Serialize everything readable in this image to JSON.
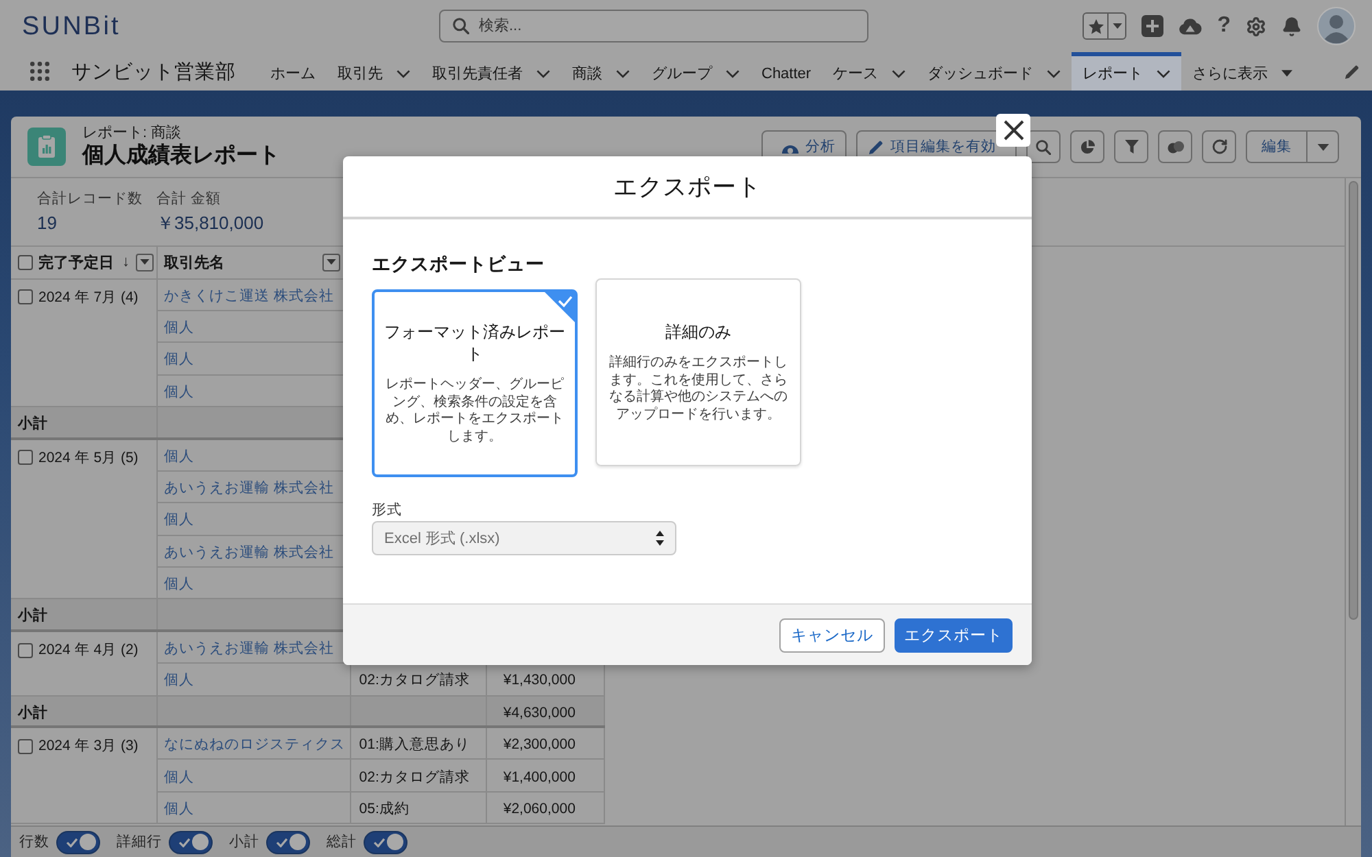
{
  "header": {
    "logo": "SUNBit",
    "search": {
      "placeholder": "検索..."
    },
    "help": "?"
  },
  "nav": {
    "app_name": "サンビット営業部",
    "items": [
      {
        "label": "ホーム",
        "menu": false,
        "selected": false
      },
      {
        "label": "取引先",
        "menu": true,
        "selected": false
      },
      {
        "label": "取引先責任者",
        "menu": true,
        "selected": false
      },
      {
        "label": "商談",
        "menu": true,
        "selected": false
      },
      {
        "label": "グループ",
        "menu": true,
        "selected": false
      },
      {
        "label": "Chatter",
        "menu": false,
        "selected": false
      },
      {
        "label": "ケース",
        "menu": true,
        "selected": false
      },
      {
        "label": "ダッシュボード",
        "menu": true,
        "selected": false
      },
      {
        "label": "レポート",
        "menu": true,
        "selected": true
      }
    ],
    "more": "さらに表示"
  },
  "report": {
    "type_label": "レポート: 商談",
    "title": "個人成績表レポート",
    "actions": [
      {
        "kind": "analyze",
        "label": "分析"
      },
      {
        "kind": "edit_fields",
        "label": "項目編集を有効"
      },
      {
        "kind": "search"
      },
      {
        "kind": "chart"
      },
      {
        "kind": "filter"
      },
      {
        "kind": "circles"
      },
      {
        "kind": "refresh"
      },
      {
        "kind": "edit",
        "label": "編集"
      }
    ]
  },
  "summary": [
    {
      "label": "合計レコード数",
      "value": "19"
    },
    {
      "label": "合計 金額",
      "value": "￥35,810,000"
    }
  ],
  "table": {
    "header_checkbox": {
      "checked": false
    },
    "columns": [
      {
        "label": "完了予定日",
        "sort_mark": "↓"
      },
      {
        "label": "取引先名"
      }
    ],
    "groups": [
      {
        "label": "2024 年 7月 (4)",
        "checked": false,
        "rows": [
          {
            "account": "かきくけこ運送 株式会社"
          },
          {
            "account": "個人"
          },
          {
            "account": "個人"
          },
          {
            "account": "個人"
          }
        ],
        "subtotal": {
          "label": "小計"
        }
      },
      {
        "label": "2024 年 5月 (5)",
        "checked": false,
        "rows": [
          {
            "account": "個人"
          },
          {
            "account": "あいうえお運輸 株式会社"
          },
          {
            "account": "個人"
          },
          {
            "account": "あいうえお運輸 株式会社"
          },
          {
            "account": "個人"
          }
        ],
        "subtotal": {
          "label": "小計"
        }
      },
      {
        "label": "2024 年 4月 (2)",
        "checked": false,
        "rows": [
          {
            "account": "あいうえお運輸 株式会社"
          },
          {
            "account": "個人",
            "column_3": "02:カタログ請求",
            "column_4": "¥1,430,000"
          }
        ],
        "subtotal": {
          "label": "小計",
          "column_4": "¥4,630,000"
        }
      },
      {
        "label": "2024 年 3月 (3)",
        "checked": false,
        "rows": [
          {
            "account": "なにぬねのロジスティクス",
            "column_3": "01:購入意思あり",
            "column_4": "¥2,300,000"
          },
          {
            "account": "個人",
            "column_3": "02:カタログ請求",
            "column_4": "¥1,400,000"
          },
          {
            "account": "個人",
            "column_3": "05:成約",
            "column_4": "¥2,060,000"
          }
        ]
      }
    ]
  },
  "footer_toggles": [
    {
      "label": "行数",
      "on": true
    },
    {
      "label": "詳細行",
      "on": true
    },
    {
      "label": "小計",
      "on": true
    },
    {
      "label": "総計",
      "on": true
    }
  ],
  "dialog": {
    "title": "エクスポート",
    "section_title": "エクスポートビュー",
    "views": [
      {
        "title": "フォーマット済みレポート",
        "description": "レポートヘッダー、グルーピング、検索条件の設定を含め、レポートをエクスポートします。",
        "selected": true
      },
      {
        "title": "詳細のみ",
        "description": "詳細行のみをエクスポートします。これを使用して、さらなる計算や他のシステムへのアップロードを行います。",
        "selected": false
      }
    ],
    "format": {
      "label": "形式",
      "value": "Excel 形式 (.xlsx)",
      "disabled": true
    },
    "buttons": [
      {
        "label": "キャンセル",
        "kind": "neutral"
      },
      {
        "label": "エクスポート",
        "kind": "brand"
      }
    ]
  }
}
